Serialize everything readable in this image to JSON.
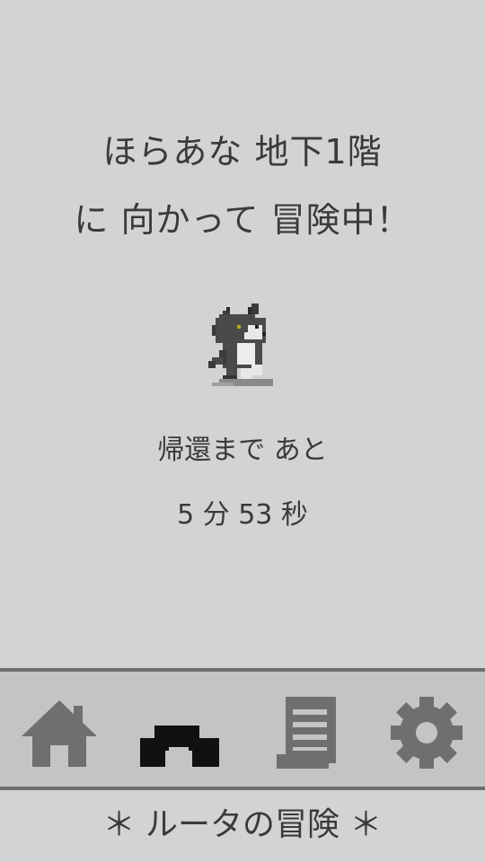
{
  "status": {
    "line1": "ほらあな 地下1階",
    "line2": "に 向かって 冒険中！",
    "return_label": "帰還まで あと",
    "timer": "5 分 53 秒"
  },
  "tabs": [
    {
      "icon": "home-icon",
      "active": false
    },
    {
      "icon": "cave-icon",
      "active": true
    },
    {
      "icon": "scroll-icon",
      "active": false
    },
    {
      "icon": "gear-icon",
      "active": false
    }
  ],
  "footer": {
    "title": "＊ ルータの冒険 ＊"
  },
  "colors": {
    "background": "#d3d3d3",
    "tabbar": "#c4c4c4",
    "divider": "#6d6d6d",
    "icon_inactive": "#6f6f6f",
    "icon_active": "#111111",
    "text": "#3a3a3a"
  }
}
